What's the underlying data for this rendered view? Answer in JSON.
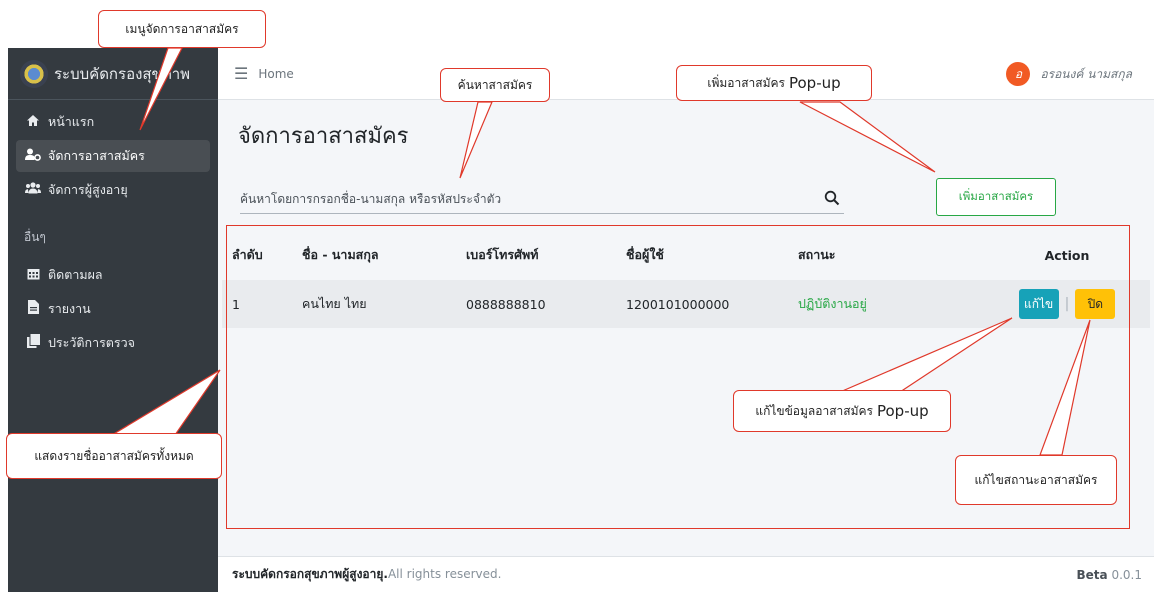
{
  "sidebar": {
    "brand": "ระบบคัดกรองสุขภาพ",
    "items": [
      {
        "label": "หน้าแรก",
        "icon": "home-icon"
      },
      {
        "label": "จัดการอาสาสมัคร",
        "icon": "user-cog-icon",
        "active": true
      },
      {
        "label": "จัดการผู้สูงอายุ",
        "icon": "users-icon"
      }
    ],
    "section_header": "อื่นๆ",
    "other_items": [
      {
        "label": "ติดตามผล",
        "icon": "calendar-icon"
      },
      {
        "label": "รายงาน",
        "icon": "file-icon"
      },
      {
        "label": "ประวัติการตรวจ",
        "icon": "copy-icon"
      }
    ]
  },
  "topbar": {
    "home": "Home",
    "user_initial": "อ",
    "user_name": "อรอนงค์ นามสกุล"
  },
  "main": {
    "title": "จัดการอาสาสมัคร",
    "search_placeholder": "ค้นหาโดยการกรอกชื่อ-นามสกุล หรือรหัสประจำตัว",
    "add_button": "เพิ่มอาสาสมัคร"
  },
  "table": {
    "headers": [
      "ลำดับ",
      "ชื่อ - นามสกุล",
      "เบอร์โทรศัพท์",
      "ชื่อผู้ใช้",
      "สถานะ",
      "Action"
    ],
    "rows": [
      {
        "no": "1",
        "name": "คนไทย ไทย",
        "phone": "0888888810",
        "username": "1200101000000",
        "status": "ปฏิบัติงานอยู่",
        "edit": "แก้ไข",
        "close": "ปิด"
      }
    ]
  },
  "footer": {
    "brand": "ระบบคัดกรอกสุขภาพผู้สูงอายุ.",
    "rights": "All rights reserved.",
    "version_label": "Beta",
    "version": "0.0.1"
  },
  "annotations": {
    "menu": "เมนูจัดการอาสาสมัคร",
    "search": "ค้นหาสาสมัคร",
    "add_popup": "เพิ่มอาสาสมัคร",
    "popup_word": "Pop-up",
    "list_all": "แสดงรายชื่ออาสาสมัครทั้งหมด",
    "edit_popup": "แก้ไขข้อมูลอาสาสมัคร",
    "edit_status": "แก้ไขสถานะอาสาสมัคร"
  },
  "colors": {
    "sidebar_bg": "#343a40",
    "accent_green": "#28a745",
    "edit_btn": "#17a2b8",
    "close_btn": "#ffc107",
    "annotation_red": "#e0392b"
  }
}
